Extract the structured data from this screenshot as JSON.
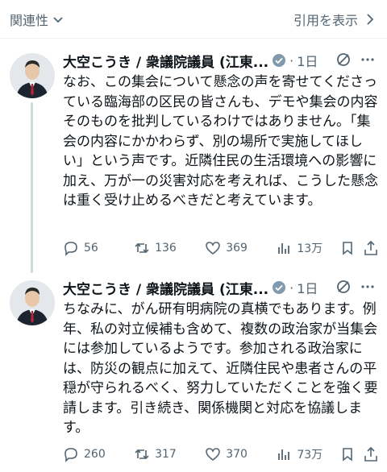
{
  "topbar": {
    "related_label": "関連性",
    "quote_label": "引用を表示"
  },
  "tweets": [
    {
      "author": "大空こうき / 衆議院議員 (江東...",
      "time": "1日",
      "text": "なお、この集会について懸念の声を寄せてくださっている臨海部の区民の皆さんも、デモや集会の内容そのものを批判しているわけではありません。「集会の内容にかかわらず、別の場所で実施してほしい」という声です。近隣住民の生活環境への影響に加え、万が一の災害対応を考えれば、こうした懸念は重く受け止めるべきだと考えています。",
      "replies": "56",
      "retweets": "136",
      "likes": "369",
      "views": "13万"
    },
    {
      "author": "大空こうき / 衆議院議員 (江東...",
      "time": "1日",
      "text": "ちなみに、がん研有明病院の真横でもあります。例年、私の対立候補も含めて、複数の政治家が当集会には参加しているようです。参加される政治家には、防災の観点に加えて、近隣住民や患者さんの平穏が守られるべく、努力していただくことを強く要請します。引き続き、関係機関と対応を協議します。",
      "replies": "260",
      "retweets": "317",
      "likes": "370",
      "views": "73万"
    }
  ],
  "colors": {
    "text": "#0f1419",
    "muted": "#536471",
    "verified": "#829aab",
    "thread_line": "#cfd9de"
  }
}
